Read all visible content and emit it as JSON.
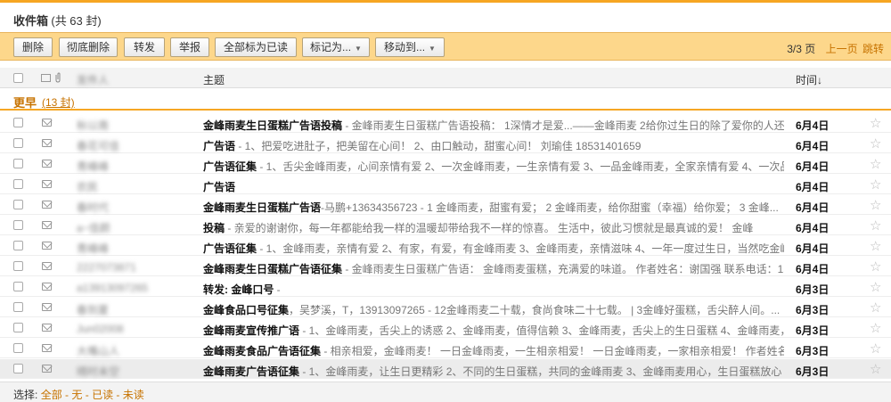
{
  "title": {
    "main": "收件箱",
    "sub": "(共 63 封)"
  },
  "toolbar": {
    "delete": "删除",
    "delete_permanently": "彻底删除",
    "forward": "转发",
    "report": "举报",
    "mark_all_read": "全部标为已读",
    "mark_as": "标记为...",
    "move_to": "移动到...",
    "arrow": "▼"
  },
  "pager": {
    "page": "3/3 页",
    "prev": "上一页",
    "jump": "跳转"
  },
  "header": {
    "sender": "发件人",
    "subject": "主题",
    "time": "时间↓",
    "attach_icon": "paperclip-icon"
  },
  "group": {
    "label": "更早",
    "count": "(13 封)"
  },
  "emails": [
    {
      "sender": "秋以南",
      "subject": "金峰雨麦生日蛋糕广告语投稿",
      "preview": " - 金峰雨麦生日蛋糕广告语投稿： 1深情才是爱...——金峰雨麦 2给你过生日的除了爱你的人还...",
      "date": "6月4日"
    },
    {
      "sender": "春花可佳",
      "subject": "广告语",
      "preview": " - 1、把爱吃进肚子，把美留在心间！ 2、由口触动，甜蜜心间！ 刘瑜佳 18531401659",
      "date": "6月4日"
    },
    {
      "sender": "青峰峰",
      "subject": "广告语征集",
      "preview": " - 1、舌尖金峰雨麦，心间亲情有爱 2、一次金峰雨麦，一生亲情有爱 3、一品金峰雨麦，全家亲情有爱 4、一次品",
      "date": "6月4日"
    },
    {
      "sender": "农民",
      "subject": "广告语",
      "preview": "",
      "date": "6月4日"
    },
    {
      "sender": "春时代",
      "subject": "金峰雨麦生日蛋糕广告语",
      "preview": "-马鹏+13634356723 - 1 金峰雨麦，甜蜜有爱； 2 金峰雨麦，给你甜蜜（幸福）给你爱； 3 金峰...",
      "date": "6月4日"
    },
    {
      "sender": "a~佳颜",
      "subject": "投稿",
      "preview": " - 亲爱的谢谢你，每一年都能给我一样的温暖却带给我不一样的惊喜。 生活中，彼此习惯就是最真诚的爱！ 金峰",
      "date": "6月4日"
    },
    {
      "sender": "青峰峰",
      "subject": "广告语征集",
      "preview": " - 1、金峰雨麦，亲情有爱 2、有家，有爱，有金峰雨麦 3、金峰雨麦，亲情滋味 4、一年一度过生日，当然吃金峰",
      "date": "6月4日"
    },
    {
      "sender": "2227073871",
      "subject": "金峰雨麦生日蛋糕广告语征集",
      "preview": " - 金峰雨麦生日蛋糕广告语： 金峰雨麦蛋糕，充满爱的味道。 作者姓名：谢国强 联系电话：15...",
      "date": "6月4日"
    },
    {
      "sender": "a13913097265",
      "subject": "转发: 金峰口号",
      "preview": " -",
      "date": "6月3日"
    },
    {
      "sender": "春到夏",
      "subject": "金峰食品口号征集",
      "preview": "，吴梦溪，T，13913097265 - 12金峰雨麦二十载，食尚食味二十七载。 | 3金峰好蛋糕，舌尖醉人间。...",
      "date": "6月3日"
    },
    {
      "sender": "Jun02008",
      "subject": "金峰雨麦宣传推广语",
      "preview": " - 1、金峰雨麦，舌尖上的诱惑 2、金峰雨麦，值得信赖 3、金峰雨麦，舌尖上的生日蛋糕 4、金峰雨麦，...",
      "date": "6月3日"
    },
    {
      "sender": "大嘴山人",
      "subject": "金峰雨麦食品广告语征集",
      "preview": " - 相亲相爱，金峰雨麦！ 一日金峰雨麦，一生相亲相爱！ 一日金峰雨麦，一家相亲相爱！ 作者姓名...",
      "date": "6月3日"
    },
    {
      "sender": "晴时未空",
      "subject": "金峰雨麦广告语征集",
      "preview": " - 1、金峰雨麦，让生日更精彩 2、不同的生日蛋糕，共同的金峰雨麦 3、金峰雨麦用心，生日蛋糕放心 4...",
      "date": "6月3日"
    }
  ],
  "footer": {
    "label": "选择:",
    "all": "全部",
    "none": "无",
    "read": "已读",
    "unread": "未读",
    "sep": " - "
  },
  "colors": {
    "accent": "#f6a623",
    "toolbar_bg": "#fdd78b",
    "link": "#c77300"
  }
}
